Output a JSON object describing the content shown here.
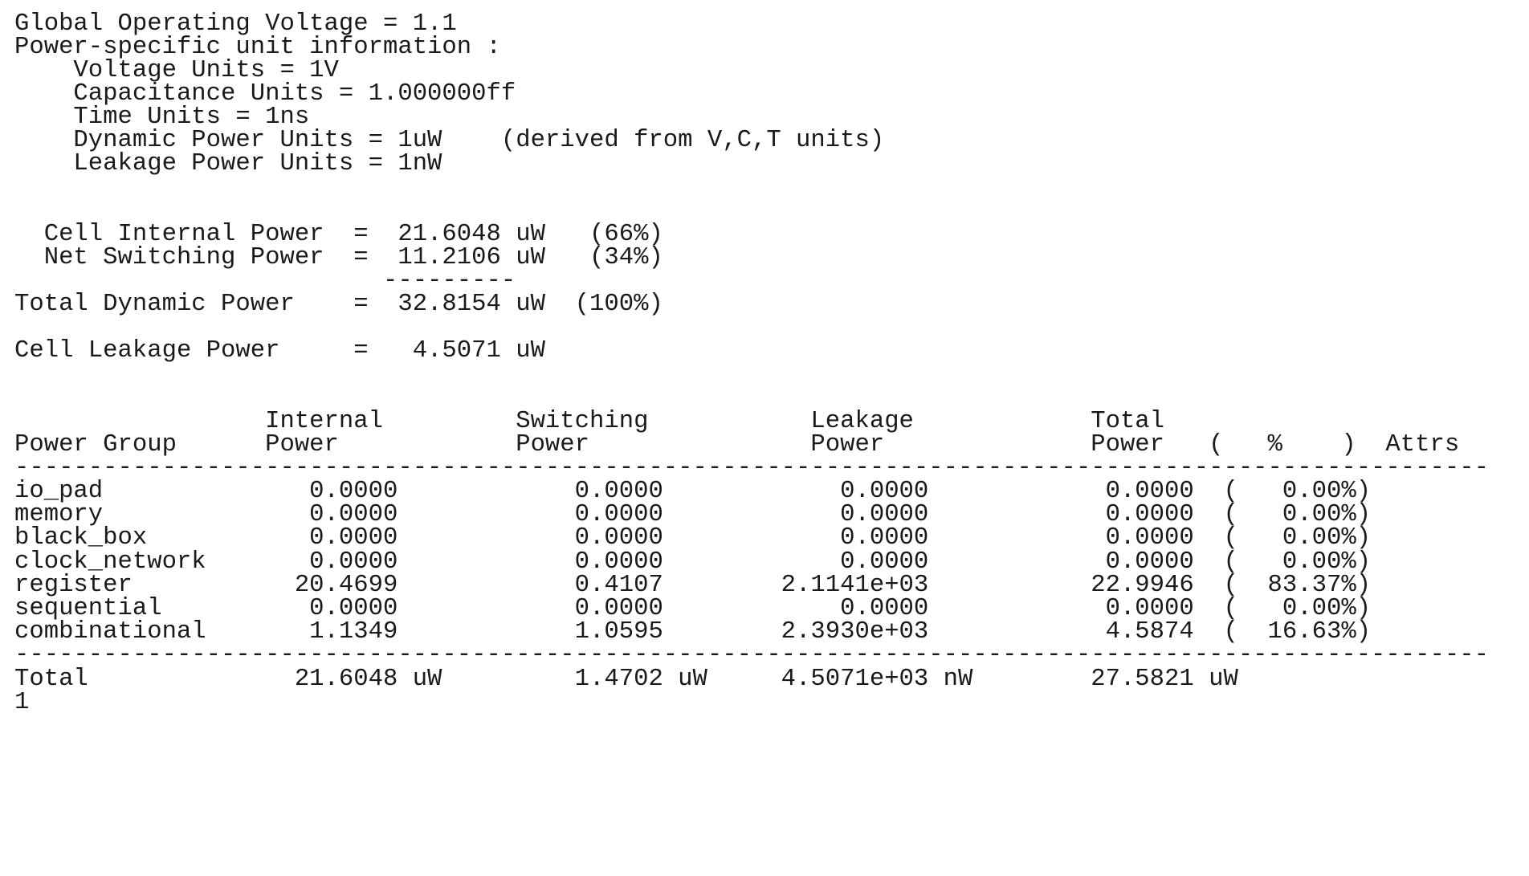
{
  "lines": [
    "Global Operating Voltage = 1.1",
    "Power-specific unit information :",
    "    Voltage Units = 1V",
    "    Capacitance Units = 1.000000ff",
    "    Time Units = 1ns",
    "    Dynamic Power Units = 1uW    (derived from V,C,T units)",
    "    Leakage Power Units = 1nW",
    "  Cell Internal Power  =  21.6048 uW   (66%)",
    "  Net Switching Power  =  11.2106 uW   (34%)",
    "                         ---------",
    "Total Dynamic Power    =  32.8154 uW  (100%)",
    "Cell Leakage Power     =   4.5071 uW",
    "                 Internal         Switching           Leakage            Total",
    "Power Group      Power            Power               Power              Power   (   %    )  Attrs",
    "----------------------------------------------------------------------------------------------------",
    "io_pad              0.0000            0.0000            0.0000            0.0000  (   0.00%)",
    "memory              0.0000            0.0000            0.0000            0.0000  (   0.00%)",
    "black_box           0.0000            0.0000            0.0000            0.0000  (   0.00%)",
    "clock_network       0.0000            0.0000            0.0000            0.0000  (   0.00%)",
    "register           20.4699            0.4107        2.1141e+03           22.9946  (  83.37%)",
    "sequential          0.0000            0.0000            0.0000            0.0000  (   0.00%)",
    "combinational       1.1349            1.0595        2.3930e+03            4.5874  (  16.63%)",
    "----------------------------------------------------------------------------------------------------",
    "Total              21.6048 uW         1.4702 uW     4.5071e+03 nW        27.5821 uW",
    "1"
  ]
}
